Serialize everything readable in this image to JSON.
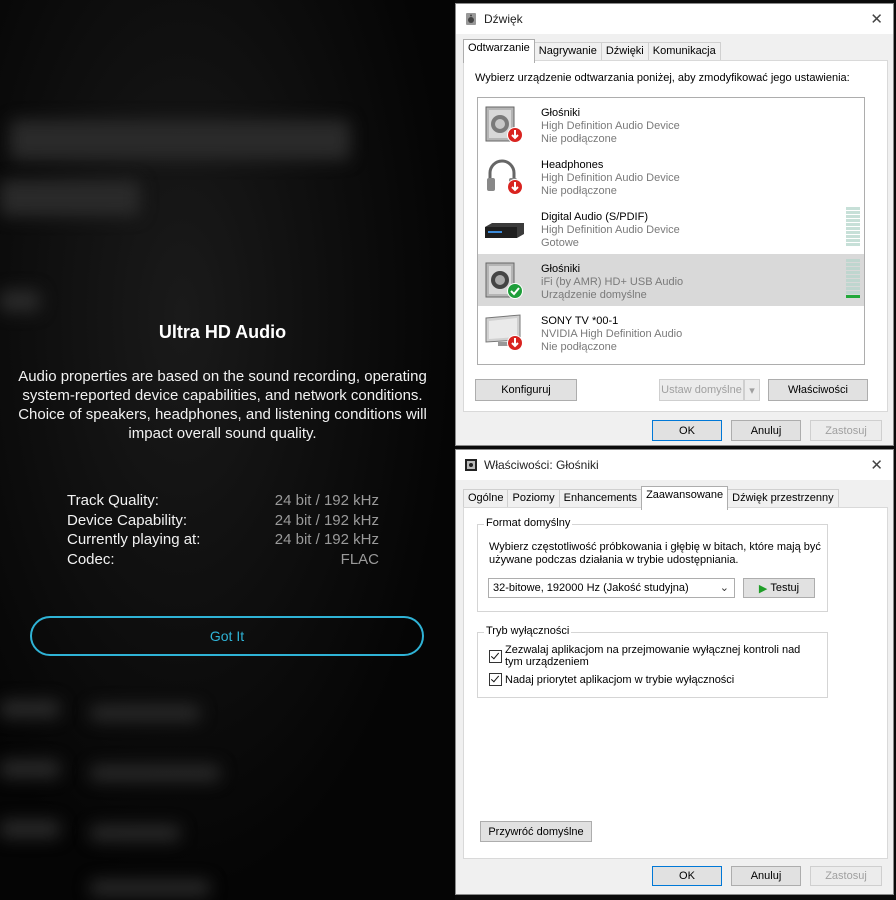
{
  "overlay": {
    "title": "Ultra HD Audio",
    "description": "Audio properties are based on the sound recording, operating system-reported device capabilities, and network conditions. Choice of speakers, headphones, and listening conditions will impact overall sound quality.",
    "specs": [
      {
        "label": "Track Quality:",
        "value": "24 bit / 192 kHz"
      },
      {
        "label": "Device Capability:",
        "value": "24 bit / 192 kHz"
      },
      {
        "label": "Currently playing at:",
        "value": "24 bit / 192 kHz"
      },
      {
        "label": "Codec:",
        "value": "FLAC"
      }
    ],
    "button": "Got It"
  },
  "sound_dialog": {
    "title": "Dźwięk",
    "tabs": [
      "Odtwarzanie",
      "Nagrywanie",
      "Dźwięki",
      "Komunikacja"
    ],
    "instruction": "Wybierz urządzenie odtwarzania poniżej, aby zmodyfikować jego ustawienia:",
    "devices": [
      {
        "name": "Głośniki",
        "driver": "High Definition Audio Device",
        "status": "Nie podłączone",
        "icon": "speaker-icon",
        "badge": "disconnected-arrow-icon"
      },
      {
        "name": "Headphones",
        "driver": "High Definition Audio Device",
        "status": "Nie podłączone",
        "icon": "headphones-icon",
        "badge": "disconnected-arrow-icon"
      },
      {
        "name": "Digital Audio (S/PDIF)",
        "driver": "High Definition Audio Device",
        "status": "Gotowe",
        "icon": "digital-audio-device-icon",
        "badge": ""
      },
      {
        "name": "Głośniki",
        "driver": "iFi (by AMR) HD+ USB Audio",
        "status": "Urządzenie domyślne",
        "icon": "speaker-icon",
        "badge": "default-check-icon"
      },
      {
        "name": "SONY TV  *00-1",
        "driver": "NVIDIA High Definition Audio",
        "status": "Nie podłączone",
        "icon": "tv-monitor-icon",
        "badge": "disconnected-arrow-icon"
      }
    ],
    "configure": "Konfiguruj",
    "set_default": "Ustaw domyślne",
    "properties": "Właściwości",
    "ok": "OK",
    "cancel": "Anuluj",
    "apply": "Zastosuj"
  },
  "props_dialog": {
    "title": "Właściwości: Głośniki",
    "tabs": [
      "Ogólne",
      "Poziomy",
      "Enhancements",
      "Zaawansowane",
      "Dźwięk przestrzenny"
    ],
    "format_group": "Format domyślny",
    "format_desc": "Wybierz częstotliwość próbkowania i głębię w bitach, które mają być używane podczas działania w trybie udostępniania.",
    "format_value": "32-bitowe, 192000 Hz (Jakość studyjna)",
    "test": "Testuj",
    "exclusive_group": "Tryb wyłączności",
    "exclusive_opt1": "Zezwalaj aplikacjom na przejmowanie wyłącznej kontroli nad tym urządzeniem",
    "exclusive_opt2": "Nadaj priorytet aplikacjom w trybie wyłączności",
    "restore": "Przywróć domyślne",
    "ok": "OK",
    "cancel": "Anuluj",
    "apply": "Zastosuj"
  }
}
